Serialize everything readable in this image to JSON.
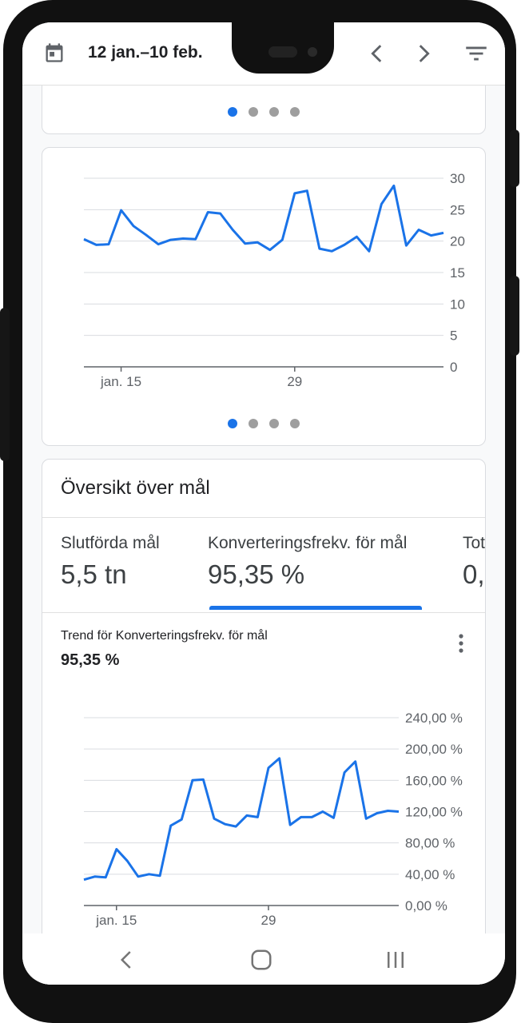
{
  "header": {
    "date_range": "12 jan.–10 feb.",
    "icons": [
      "calendar-icon",
      "chevron-left-icon",
      "chevron-right-icon",
      "filter-icon"
    ]
  },
  "pager": {
    "count": 4,
    "active": 0
  },
  "chart_data": [
    {
      "type": "line",
      "title": "",
      "x_tick_labels": [
        "jan. 15",
        "29"
      ],
      "y_tick_labels": [
        "0",
        "5",
        "10",
        "15",
        "20",
        "25",
        "30"
      ],
      "ylim": [
        0,
        30
      ],
      "grid": true,
      "color": "#1a73e8",
      "series": [
        {
          "values": [
            20.3,
            19.4,
            19.5,
            24.9,
            22.4,
            21.0,
            19.5,
            20.2,
            20.4,
            20.3,
            24.6,
            24.4,
            21.8,
            19.6,
            19.8,
            18.6,
            20.2,
            27.6,
            28.0,
            18.8,
            18.4,
            19.4,
            20.7,
            18.4,
            25.9,
            28.8,
            19.3,
            21.8,
            20.9,
            21.3
          ]
        }
      ]
    },
    {
      "type": "line",
      "title": "Trend för Konverteringsfrekv. för mål",
      "x_tick_labels": [
        "jan. 15",
        "29"
      ],
      "y_tick_labels": [
        "0,00 %",
        "40,00 %",
        "80,00 %",
        "120,00 %",
        "160,00 %",
        "200,00 %",
        "240,00 %"
      ],
      "ylim": [
        0,
        240
      ],
      "grid": true,
      "color": "#1a73e8",
      "series": [
        {
          "values": [
            33,
            37,
            36,
            72,
            57,
            37,
            40,
            38,
            102,
            110,
            160,
            161,
            111,
            104,
            101,
            115,
            113,
            176,
            188,
            103,
            113,
            113,
            120,
            112,
            170,
            184,
            111,
            118,
            121,
            120
          ]
        }
      ]
    }
  ],
  "overview": {
    "title": "Översikt över mål",
    "tabs": [
      {
        "label": "Slutförda mål",
        "value": "5,5 tn"
      },
      {
        "label": "Konverteringsfrekv. för mål",
        "value": "95,35 %"
      },
      {
        "label": "Tot",
        "value": "0,"
      }
    ],
    "active_tab": 1,
    "trend_title": "Trend för Konverteringsfrekv. för mål",
    "trend_value": "95,35 %"
  },
  "navbar": {
    "icons": [
      "back-icon",
      "home-icon",
      "recents-icon"
    ]
  }
}
